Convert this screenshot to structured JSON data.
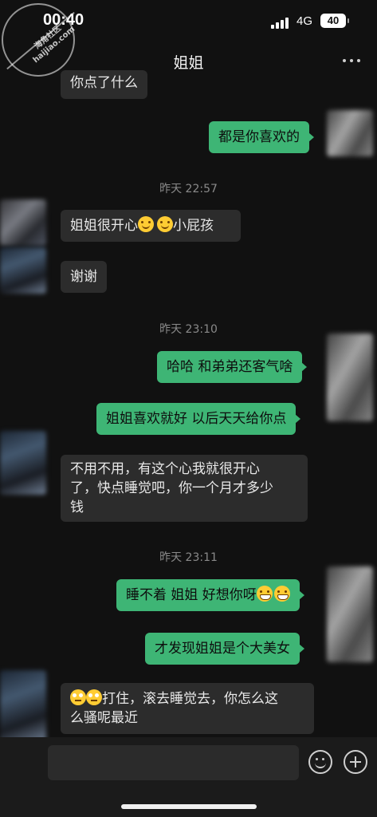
{
  "status_bar": {
    "time": "00:40",
    "network": "4G",
    "battery": "40",
    "watermark_lines": [
      "海角社区",
      "haijiao.com"
    ]
  },
  "nav": {
    "title": "姐姐",
    "more_icon": "more-dots-icon"
  },
  "messages": [
    {
      "side": "left",
      "text": "你点了什么"
    },
    {
      "side": "right",
      "text": "都是你喜欢的"
    },
    {
      "type": "time",
      "text": "昨天 22:57"
    },
    {
      "side": "left",
      "text_a": "姐姐很开心",
      "text_b": "小屁孩",
      "emojis": [
        "smiling-face",
        "smiling-face"
      ]
    },
    {
      "side": "left",
      "text": "谢谢"
    },
    {
      "type": "time",
      "text": "昨天 23:10"
    },
    {
      "side": "right",
      "text": "哈哈 和弟弟还客气啥"
    },
    {
      "side": "right",
      "text": "姐姐喜欢就好 以后天天给你点"
    },
    {
      "side": "left",
      "lines": [
        "不用不用，有这个心我就很开心",
        "了，快点睡觉吧，你一个月才多少",
        "钱"
      ]
    },
    {
      "type": "time",
      "text": "昨天 23:11"
    },
    {
      "side": "right",
      "text": "睡不着 姐姐 好想你呀",
      "emojis": [
        "grinning-face",
        "grinning-face"
      ]
    },
    {
      "side": "right",
      "text": "才发现姐姐是个大美女"
    },
    {
      "side": "left",
      "lines": [
        "打住，滚去睡觉去，你怎么这",
        "么骚呢最近"
      ],
      "emojis": [
        "eye-roll-face",
        "eye-roll-face"
      ]
    }
  ],
  "input_bar": {
    "emoji_button_icon": "emoji-icon",
    "plus_button_icon": "plus-icon"
  },
  "colors": {
    "background": "#111111",
    "bubble_left": "#2c2c2c",
    "bubble_right": "#3eb575"
  }
}
